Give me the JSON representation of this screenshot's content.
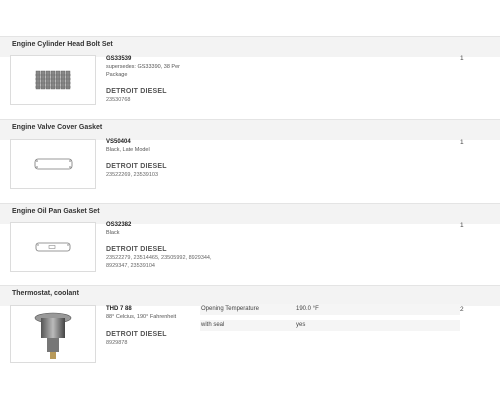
{
  "sections": [
    {
      "title": "Engine Cylinder Head Bolt Set",
      "icon": "bolt-set-thumbnail",
      "part_number": "GS33539",
      "description": "supersedes: GS33390, 38 Per Package",
      "brand": "DETROIT DIESEL",
      "references": "23530768",
      "quantity": "1"
    },
    {
      "title": "Engine Valve Cover Gasket",
      "icon": "valve-cover-gasket-thumbnail",
      "part_number": "VS50404",
      "description": "Black, Late Model",
      "brand": "DETROIT DIESEL",
      "references": "23522269, 23539103",
      "quantity": "1"
    },
    {
      "title": "Engine Oil Pan Gasket Set",
      "icon": "oil-pan-gasket-thumbnail",
      "part_number": "OS32382",
      "description": "Black",
      "brand": "DETROIT DIESEL",
      "references": "23522279, 23514465, 23505992, 8929344, 8929347, 23539104",
      "quantity": "1"
    },
    {
      "title": "Thermostat, coolant",
      "icon": "thermostat-thumbnail",
      "part_number": "THD 7 88",
      "description": "88° Celcius, 190° Fahrenheit",
      "brand": "DETROIT DIESEL",
      "references": "8929878",
      "quantity": "2",
      "specs": [
        {
          "label": "Opening Temperature",
          "value": "190.0 °F"
        },
        {
          "label": "with seal",
          "value": "yes"
        }
      ]
    }
  ]
}
